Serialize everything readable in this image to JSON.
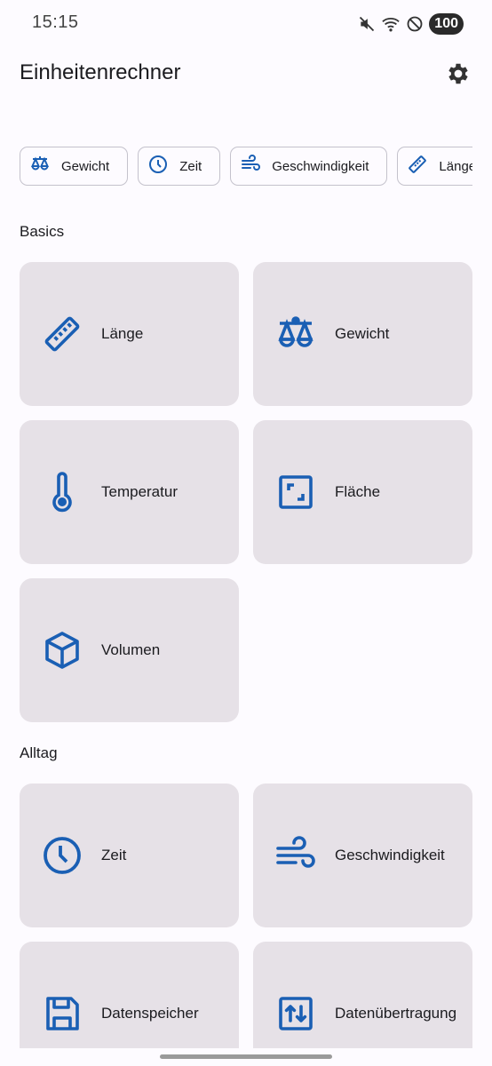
{
  "status": {
    "time": "15:15",
    "battery": "100",
    "icons": [
      "mute-icon",
      "wifi-icon",
      "do-not-disturb-icon"
    ]
  },
  "app": {
    "title": "Einheitenrechner",
    "settings_icon": "gear-icon"
  },
  "colors": {
    "accent": "#1a5fb4",
    "card_bg": "#e6e1e7",
    "background": "#fdfbff"
  },
  "chips": [
    {
      "label": "Gewicht",
      "icon": "scale-icon"
    },
    {
      "label": "Zeit",
      "icon": "clock-icon"
    },
    {
      "label": "Geschwindigkeit",
      "icon": "wind-icon"
    },
    {
      "label": "Länge",
      "icon": "ruler-icon"
    }
  ],
  "sections": [
    {
      "title": "Basics",
      "cards": [
        {
          "label": "Länge",
          "icon": "ruler-icon"
        },
        {
          "label": "Gewicht",
          "icon": "scale-icon"
        },
        {
          "label": "Temperatur",
          "icon": "thermometer-icon"
        },
        {
          "label": "Fläche",
          "icon": "area-icon"
        },
        {
          "label": "Volumen",
          "icon": "cube-icon"
        }
      ]
    },
    {
      "title": "Alltag",
      "cards": [
        {
          "label": "Zeit",
          "icon": "clock-icon"
        },
        {
          "label": "Geschwindigkeit",
          "icon": "wind-icon"
        },
        {
          "label": "Datenspeicher",
          "icon": "floppy-disk-icon"
        },
        {
          "label": "Datenübertragung",
          "icon": "transfer-icon"
        }
      ]
    }
  ]
}
